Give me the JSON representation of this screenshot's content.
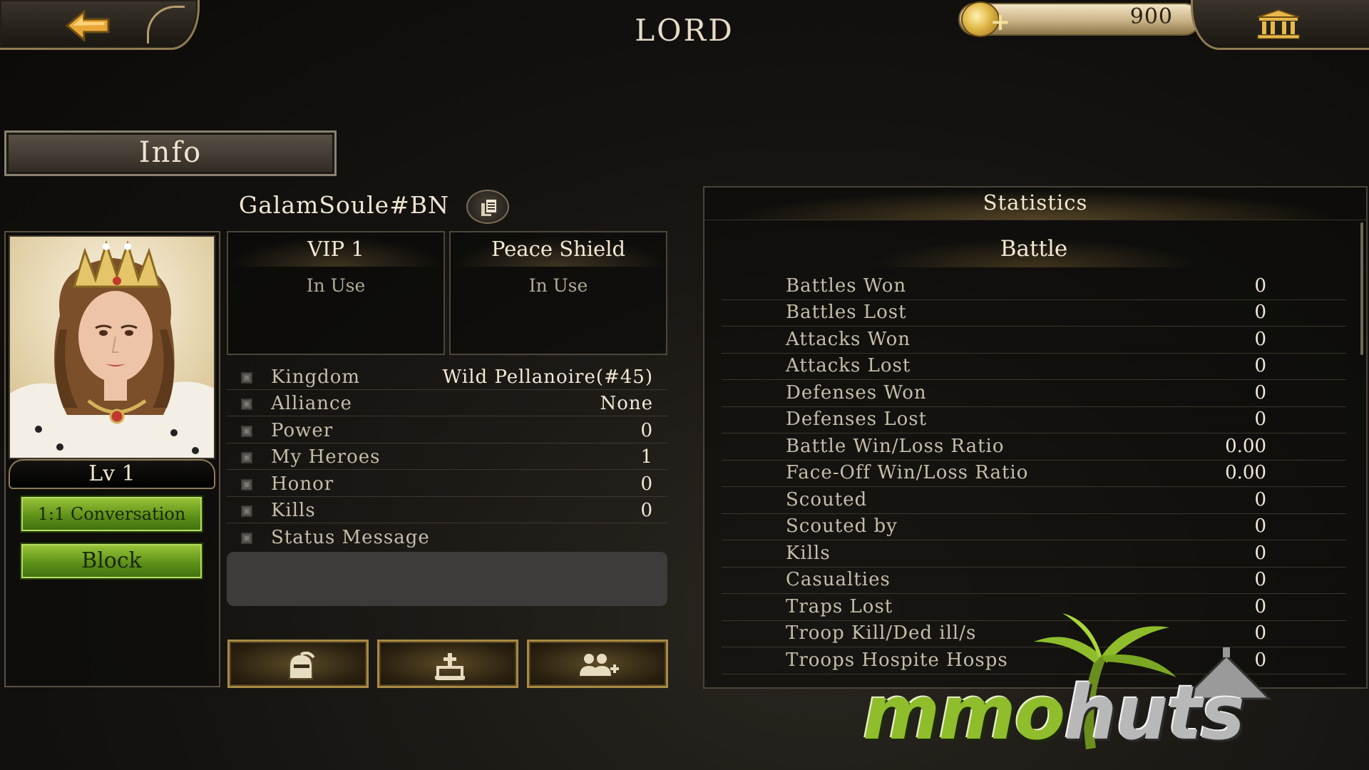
{
  "header": {
    "title": "LORD",
    "gold": "900"
  },
  "tab": {
    "label": "Info"
  },
  "player": {
    "name": "GalamSoule#BN",
    "level": "Lv 1",
    "conversation_label": "1:1 Conversation",
    "block_label": "Block"
  },
  "status_cards": [
    {
      "title": "VIP 1",
      "status": "In Use"
    },
    {
      "title": "Peace Shield",
      "status": "In Use"
    }
  ],
  "info_rows": [
    {
      "label": "Kingdom",
      "value": "Wild Pellanoire(#45)"
    },
    {
      "label": "Alliance",
      "value": "None"
    },
    {
      "label": "Power",
      "value": "0"
    },
    {
      "label": "My Heroes",
      "value": "1"
    },
    {
      "label": "Honor",
      "value": "0"
    },
    {
      "label": "Kills",
      "value": "0"
    },
    {
      "label": "Status Message",
      "value": ""
    }
  ],
  "statistics": {
    "header": "Statistics",
    "section": "Battle",
    "rows": [
      {
        "label": "Battles Won",
        "value": "0"
      },
      {
        "label": "Battles Lost",
        "value": "0"
      },
      {
        "label": "Attacks Won",
        "value": "0"
      },
      {
        "label": "Attacks Lost",
        "value": "0"
      },
      {
        "label": "Defenses Won",
        "value": "0"
      },
      {
        "label": "Defenses Lost",
        "value": "0"
      },
      {
        "label": "Battle Win/Loss Ratio",
        "value": "0.00"
      },
      {
        "label": "Face-Off Win/Loss Ratio",
        "value": "0.00"
      },
      {
        "label": "Scouted",
        "value": "0"
      },
      {
        "label": "Scouted by",
        "value": "0"
      },
      {
        "label": "Kills",
        "value": "0"
      },
      {
        "label": "Casualties",
        "value": "0"
      },
      {
        "label": "Traps Lost",
        "value": "0"
      },
      {
        "label": "Troop Kill/Ded ill/s",
        "value": "0"
      },
      {
        "label": "Troops Hospite Hosps",
        "value": "0"
      }
    ]
  },
  "watermark": {
    "main": "mmo",
    "accent": "huts"
  },
  "icons": {
    "back": "back-arrow-icon",
    "gold": "gold-coin-icon",
    "bank": "bank-icon",
    "copy": "copy-icon",
    "hero": "knight-helmet-icon",
    "tavern": "altar-icon",
    "friends": "add-friend-icon"
  },
  "colors": {
    "accent_gold": "#b59d6b",
    "button_green": "#5f9219",
    "text_light": "#f2e9d6",
    "text_muted": "#c6bea9"
  }
}
